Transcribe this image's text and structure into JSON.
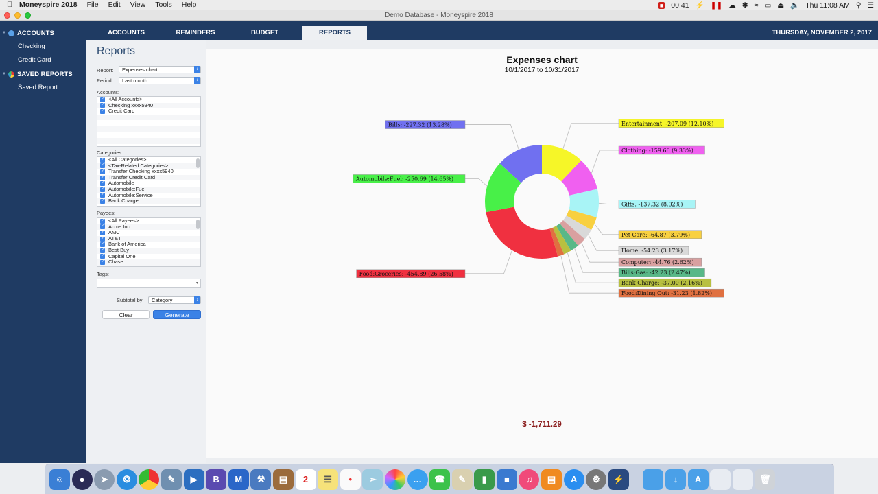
{
  "menubar": {
    "app_name": "Moneyspire 2018",
    "menus": [
      "File",
      "Edit",
      "View",
      "Tools",
      "Help"
    ],
    "recording_time": "00:41",
    "clock": "Thu 11:08 AM"
  },
  "window_title": "Demo Database - Moneyspire 2018",
  "sidebar": {
    "accounts_header": "ACCOUNTS",
    "accounts": [
      "Checking",
      "Credit Card"
    ],
    "saved_header": "SAVED REPORTS",
    "saved": [
      "Saved Report"
    ]
  },
  "tabs": [
    "ACCOUNTS",
    "REMINDERS",
    "BUDGET",
    "REPORTS"
  ],
  "active_tab": "REPORTS",
  "date_display": "THURSDAY, NOVEMBER 2, 2017",
  "panel": {
    "title": "Reports",
    "report_label": "Report:",
    "report_value": "Expenses chart",
    "period_label": "Period:",
    "period_value": "Last month",
    "accounts_label": "Accounts:",
    "accounts": [
      "<All Accounts>",
      "Checking xxxx5940",
      "Credit Card"
    ],
    "categories_label": "Categories:",
    "categories": [
      "<All Categories>",
      "<Tax-Related Categories>",
      "Transfer:Checking xxxx5940",
      "Transfer:Credit Card",
      "Automobile",
      "Automobile:Fuel",
      "Automobile:Service",
      "Bank Charge"
    ],
    "payees_label": "Payees:",
    "payees": [
      "<All Payees>",
      "Acme Inc.",
      "AMC",
      "AT&T",
      "Bank of America",
      "Best Buy",
      "Capital One",
      "Chase"
    ],
    "tags_label": "Tags:",
    "subtotal_label": "Subtotal by:",
    "subtotal_value": "Category",
    "clear_label": "Clear",
    "generate_label": "Generate"
  },
  "chart_data": {
    "type": "pie",
    "title": "Expenses chart",
    "subtitle": "10/1/2017 to 10/31/2017",
    "total": "$ -1,711.29",
    "slices": [
      {
        "label": "Entertainment",
        "value": -207.09,
        "percent": "12.10%",
        "color": "#f6f628"
      },
      {
        "label": "Clothing",
        "value": -159.66,
        "percent": "9.33%",
        "color": "#f060f0"
      },
      {
        "label": "Gifts",
        "value": -137.32,
        "percent": "8.02%",
        "color": "#a8f4f6"
      },
      {
        "label": "Pet Care",
        "value": -64.87,
        "percent": "3.79%",
        "color": "#f8d040"
      },
      {
        "label": "Home",
        "value": -54.23,
        "percent": "3.17%",
        "color": "#d9d9d9"
      },
      {
        "label": "Computer",
        "value": -44.76,
        "percent": "2.62%",
        "color": "#d9a0a0"
      },
      {
        "label": "Bills:Gas",
        "value": -42.23,
        "percent": "2.47%",
        "color": "#58b888"
      },
      {
        "label": "Bank Charge",
        "value": -37.0,
        "percent": "2.16%",
        "color": "#b8c040"
      },
      {
        "label": "Food:Dining Out",
        "value": -31.23,
        "percent": "1.82%",
        "color": "#e07040"
      },
      {
        "label": "Food:Groceries",
        "value": -454.89,
        "percent": "26.58%",
        "color": "#f03040"
      },
      {
        "label": "Automobile:Fuel",
        "value": -250.69,
        "percent": "14.65%",
        "color": "#48f048"
      },
      {
        "label": "Bills",
        "value": -227.32,
        "percent": "13.28%",
        "color": "#7070f0"
      }
    ]
  }
}
